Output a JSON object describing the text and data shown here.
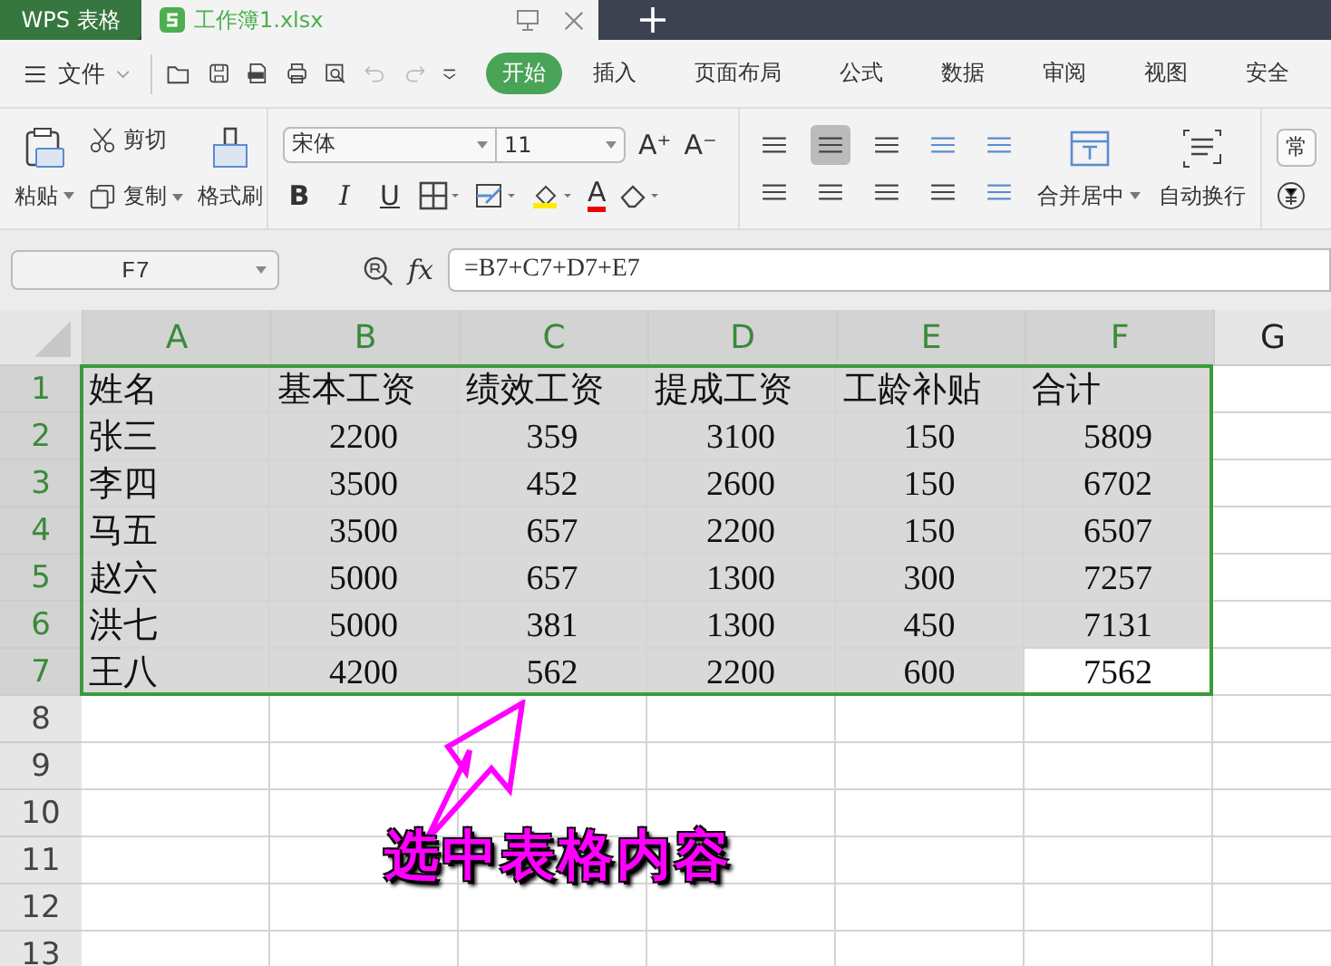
{
  "tabs": [
    {
      "label": "WPS 表格",
      "selected": false
    },
    {
      "label": "工作簿1.xlsx",
      "selected": true
    }
  ],
  "menu": {
    "file": "文件",
    "tabs": [
      {
        "label": "开始",
        "selected": true
      },
      {
        "label": "插入",
        "selected": false
      },
      {
        "label": "页面布局",
        "selected": false
      },
      {
        "label": "公式",
        "selected": false
      },
      {
        "label": "数据",
        "selected": false
      },
      {
        "label": "审阅",
        "selected": false
      },
      {
        "label": "视图",
        "selected": false
      },
      {
        "label": "安全",
        "selected": false
      }
    ]
  },
  "ribbon": {
    "paste": "粘贴",
    "cut": "剪切",
    "copy": "复制",
    "format_painter": "格式刷",
    "font": "宋体",
    "font_size": "11",
    "size_buttons": [
      "A⁺",
      "A⁻"
    ],
    "style_buttons": [
      "B",
      "I",
      "U"
    ],
    "font_color": "A",
    "merge": "合并居中",
    "wrap": "自动换行",
    "number_format": "常"
  },
  "formula_bar": {
    "name_box": "F7",
    "fx": "fx",
    "formula": "=B7+C7+D7+E7"
  },
  "sheet": {
    "columns": [
      {
        "label": "A",
        "selected": true
      },
      {
        "label": "B",
        "selected": true
      },
      {
        "label": "C",
        "selected": true
      },
      {
        "label": "D",
        "selected": true
      },
      {
        "label": "E",
        "selected": true
      },
      {
        "label": "F",
        "selected": true
      },
      {
        "label": "G",
        "selected": false
      }
    ],
    "rows": [
      {
        "number": "1",
        "selected": true,
        "cells": [
          {
            "text": "姓名",
            "active": false
          },
          {
            "text": "基本工资",
            "active": false
          },
          {
            "text": "绩效工资",
            "active": false
          },
          {
            "text": "提成工资",
            "active": false
          },
          {
            "text": "工龄补贴",
            "active": false
          },
          {
            "text": "合计",
            "active": false
          }
        ]
      },
      {
        "number": "2",
        "selected": true,
        "cells": [
          {
            "text": "张三",
            "active": false
          },
          {
            "text": "2200",
            "active": false
          },
          {
            "text": "359",
            "active": false
          },
          {
            "text": "3100",
            "active": false
          },
          {
            "text": "150",
            "active": false
          },
          {
            "text": "5809",
            "active": false
          }
        ]
      },
      {
        "number": "3",
        "selected": true,
        "cells": [
          {
            "text": "李四",
            "active": false
          },
          {
            "text": "3500",
            "active": false
          },
          {
            "text": "452",
            "active": false
          },
          {
            "text": "2600",
            "active": false
          },
          {
            "text": "150",
            "active": false
          },
          {
            "text": "6702",
            "active": false
          }
        ]
      },
      {
        "number": "4",
        "selected": true,
        "cells": [
          {
            "text": "马五",
            "active": false
          },
          {
            "text": "3500",
            "active": false
          },
          {
            "text": "657",
            "active": false
          },
          {
            "text": "2200",
            "active": false
          },
          {
            "text": "150",
            "active": false
          },
          {
            "text": "6507",
            "active": false
          }
        ]
      },
      {
        "number": "5",
        "selected": true,
        "cells": [
          {
            "text": "赵六",
            "active": false
          },
          {
            "text": "5000",
            "active": false
          },
          {
            "text": "657",
            "active": false
          },
          {
            "text": "1300",
            "active": false
          },
          {
            "text": "300",
            "active": false
          },
          {
            "text": "7257",
            "active": false
          }
        ]
      },
      {
        "number": "6",
        "selected": true,
        "cells": [
          {
            "text": "洪七",
            "active": false
          },
          {
            "text": "5000",
            "active": false
          },
          {
            "text": "381",
            "active": false
          },
          {
            "text": "1300",
            "active": false
          },
          {
            "text": "450",
            "active": false
          },
          {
            "text": "7131",
            "active": false
          }
        ]
      },
      {
        "number": "7",
        "selected": true,
        "cells": [
          {
            "text": "王八",
            "active": false
          },
          {
            "text": "4200",
            "active": false
          },
          {
            "text": "562",
            "active": false
          },
          {
            "text": "2200",
            "active": false
          },
          {
            "text": "600",
            "active": false
          },
          {
            "text": "7562",
            "active": true
          }
        ]
      },
      {
        "number": "8",
        "selected": false
      },
      {
        "number": "9",
        "selected": false
      },
      {
        "number": "10",
        "selected": false
      },
      {
        "number": "11",
        "selected": false
      },
      {
        "number": "12",
        "selected": false
      },
      {
        "number": "13",
        "selected": false
      }
    ]
  },
  "annotation": {
    "text": "选中表格内容"
  }
}
